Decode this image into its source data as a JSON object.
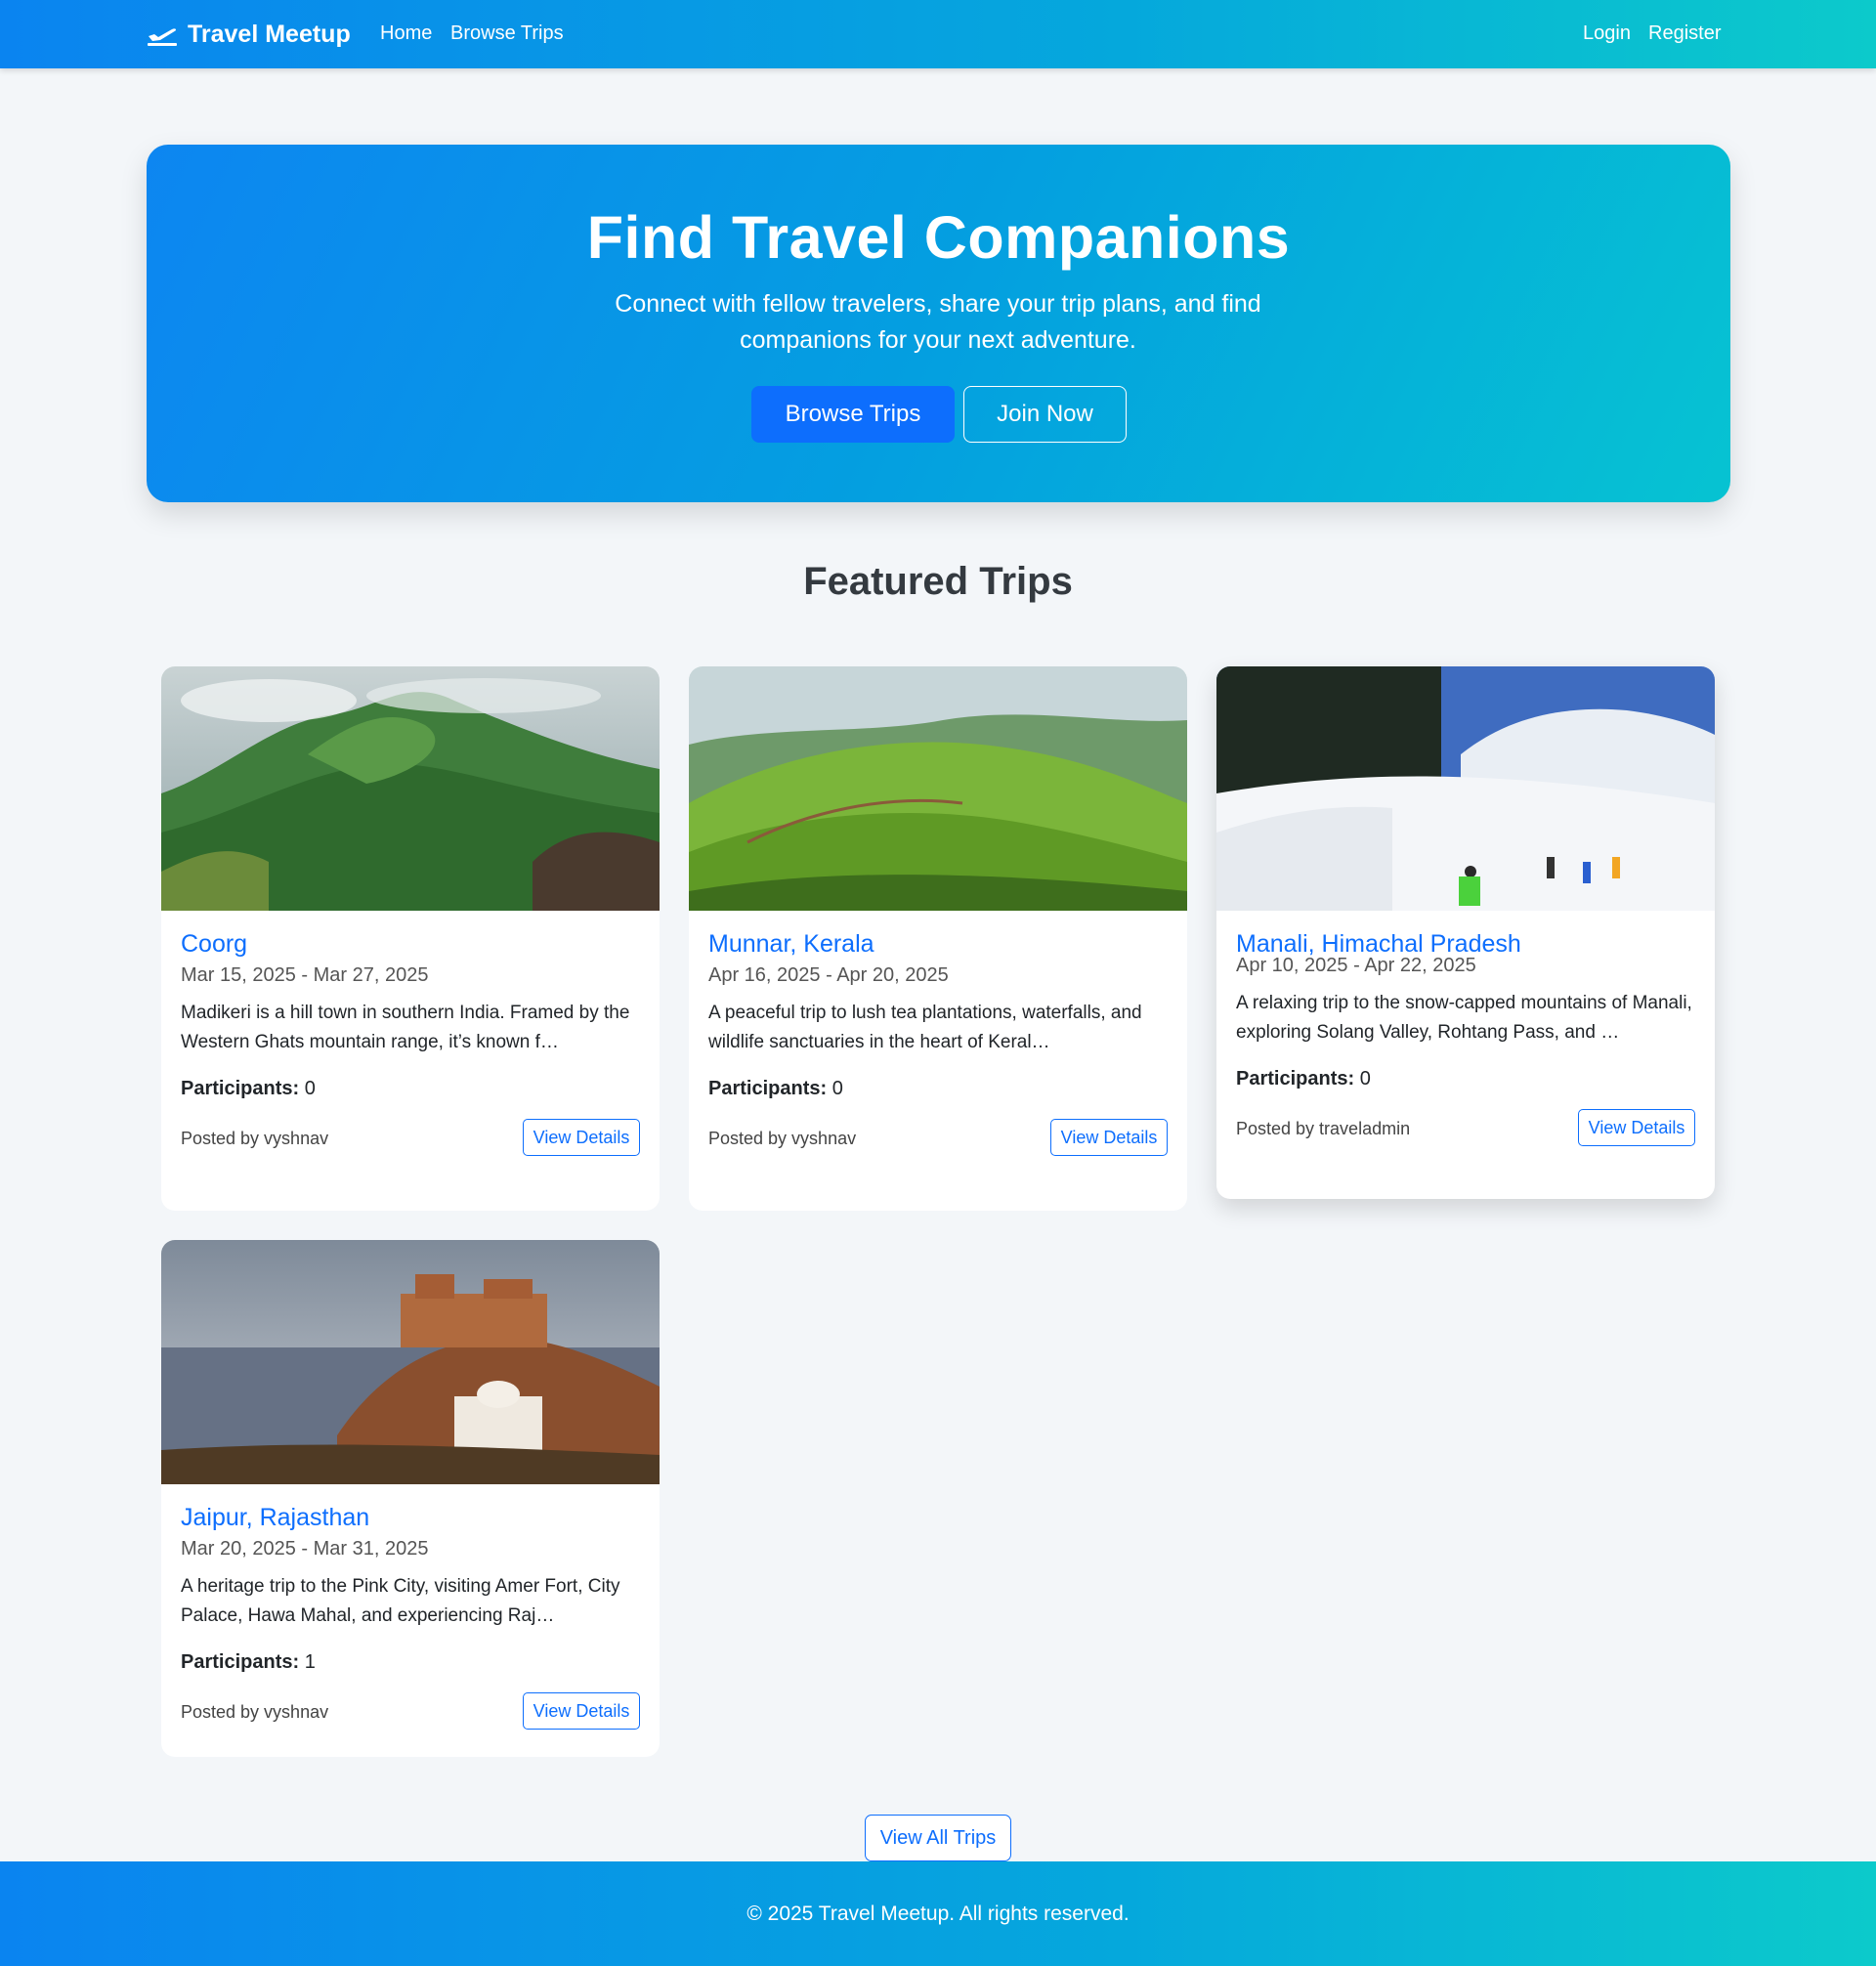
{
  "navbar": {
    "brand": "Travel Meetup",
    "links": [
      "Home",
      "Browse Trips"
    ],
    "auth": [
      "Login",
      "Register"
    ]
  },
  "hero": {
    "title": "Find Travel Companions",
    "subtitle": "Connect with fellow travelers, share your trip plans, and find companions for your next adventure.",
    "browse_label": "Browse Trips",
    "join_label": "Join Now"
  },
  "featured": {
    "title": "Featured Trips",
    "participants_label": "Participants:",
    "details_label": "View Details",
    "trips": [
      {
        "name": "Coorg",
        "dates": "Mar 15, 2025 - Mar 27, 2025",
        "description": "Madikeri is a hill town in southern India. Framed by the Western Ghats mountain range, it’s known f…",
        "participants": "0",
        "posted_by": "Posted by vyshnav",
        "image": "green-mountain-photo"
      },
      {
        "name": "Munnar, Kerala",
        "dates": "Apr 16, 2025 - Apr 20, 2025",
        "description": "A peaceful trip to lush tea plantations, waterfalls, and wildlife sanctuaries in the heart of Keral…",
        "participants": "0",
        "posted_by": "Posted by vyshnav",
        "image": "tea-plantation-photo"
      },
      {
        "name": "Manali, Himachal Pradesh",
        "dates": "Apr 10, 2025 - Apr 22, 2025",
        "description": "A relaxing trip to the snow-capped mountains of Manali, exploring Solang Valley, Rohtang Pass, and …",
        "participants": "0",
        "posted_by": "Posted by traveladmin",
        "image": "snow-valley-photo"
      },
      {
        "name": "Jaipur, Rajasthan",
        "dates": "Mar 20, 2025 - Mar 31, 2025",
        "description": "A heritage trip to the Pink City, visiting Amer Fort, City Palace, Hawa Mahal, and experiencing Raj…",
        "participants": "1",
        "posted_by": "Posted by vyshnav",
        "image": "fort-city-photo"
      }
    ]
  },
  "view_all_label": "View All Trips",
  "footer": {
    "text": "© 2025 Travel Meetup. All rights reserved."
  },
  "colors": {
    "primary": "#0d6efd",
    "gradient_start": "#0a84f0",
    "gradient_end": "#0ccacb"
  }
}
